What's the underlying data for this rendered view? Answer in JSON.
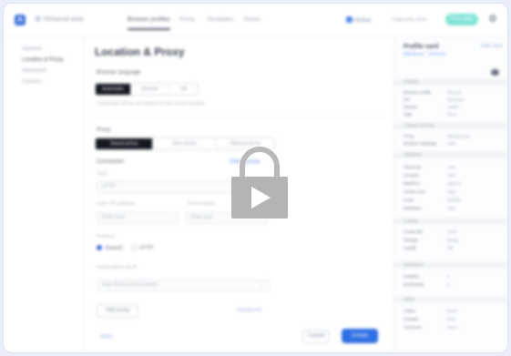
{
  "topbar": {
    "logo": "A",
    "workspace": "Personal area",
    "tabs": [
      "Browser profiles",
      "Proxy",
      "Templates",
      "Teams"
    ],
    "active_tab_index": 0,
    "status_pill": "Online",
    "upgrade": "Upgrade plan",
    "trial_badge": "Free plan",
    "gear": "⚙"
  },
  "sidebar": {
    "items": [
      "General",
      "Location & Proxy",
      "Advanced",
      "Cookies"
    ],
    "selected_index": 1
  },
  "main": {
    "title": "Location & Proxy",
    "browser_language_label": "Browser language",
    "language_options": [
      "Automatic",
      "Manual",
      "Off"
    ],
    "language_selected_index": 0,
    "language_hint": "Language will be set based on the proxy location",
    "proxy_label": "Proxy",
    "proxy_options": [
      "Saved proxy",
      "New proxy",
      "Without proxy"
    ],
    "proxy_selected_index": 0,
    "connection_label": "Connection",
    "check_link": "Check proxy",
    "type_label": "Type",
    "type_value": "HTTP",
    "host_label": "Host / IP address",
    "host_placeholder": "Enter host",
    "port_label": "Port number",
    "port_placeholder": "Enter port",
    "protocol_label": "Protocol",
    "protocol_options": [
      "Socks5",
      "HTTP"
    ],
    "protocol_selected_index": 0,
    "location_label": "Geolocation via IP",
    "location_value": "Auto-fill by proxy location",
    "add_button": "Add proxy",
    "advanced_link": "Advanced",
    "back_button": "Back",
    "cancel_button": "Cancel",
    "save_button": "Create"
  },
  "right_panel": {
    "title": "Profile card",
    "subtitle": "Windows · Chrome",
    "edit_link": "Edit card",
    "sections": [
      {
        "title": "General",
        "rows": [
          [
            "Browser profile",
            "Chrome"
          ],
          [
            "OS",
            "Windows"
          ],
          [
            "Version",
            "Latest"
          ],
          [
            "Tags",
            "None"
          ]
        ]
      },
      {
        "title": "Location & Proxy",
        "rows": [
          [
            "Proxy",
            "Saved proxy"
          ],
          [
            "Browser language",
            "Auto"
          ]
        ]
      },
      {
        "title": "Advanced",
        "rows": [
          [
            "Timezone",
            "Auto"
          ],
          [
            "Location",
            "Auto"
          ],
          [
            "WebRTC",
            "Altered"
          ],
          [
            "Screen size",
            "Auto"
          ],
          [
            "Fonts",
            "Default"
          ],
          [
            "Hardware",
            "Auto"
          ]
        ]
      },
      {
        "title": "Cookies",
        "rows": [
          [
            "Cookie file",
            "None"
          ],
          [
            "Storage",
            "Empty"
          ],
          [
            "Autofill",
            "Off"
          ]
        ]
      },
      {
        "title": "Extensions",
        "rows": [
          [
            "Installed",
            "0"
          ],
          [
            "Bookmarks",
            "0"
          ]
        ]
      },
      {
        "title": "Notes",
        "rows": [
          [
            "Author",
            "None"
          ],
          [
            "Created",
            "Now"
          ],
          [
            "Comment",
            "None"
          ]
        ]
      }
    ]
  },
  "overlay": {
    "icon": "lock-icon",
    "play": "play-icon"
  },
  "colors": {
    "accent": "#2f6fe4",
    "badge": "#7fe3d6",
    "selected_segment": "#141821"
  }
}
